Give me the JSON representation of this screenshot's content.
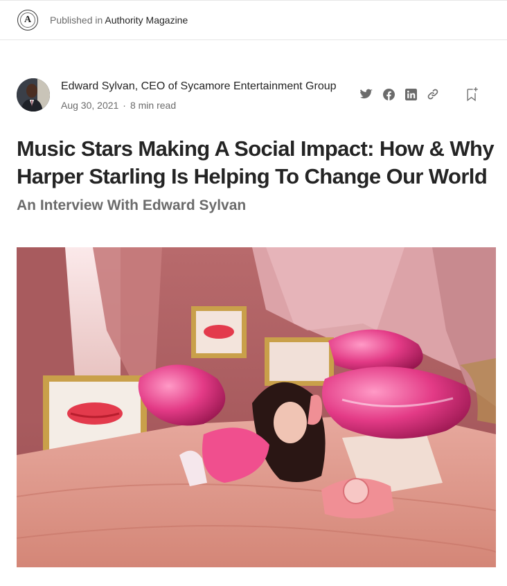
{
  "publication": {
    "prefix": "Published in",
    "name": "Authority Magazine",
    "logo_letter": "A"
  },
  "author": {
    "name": "Edward Sylvan, CEO of Sycamore Entertainment Group",
    "date": "Aug 30, 2021",
    "separator": "·",
    "read_time": "8 min read"
  },
  "share_icons": [
    "twitter-icon",
    "facebook-icon",
    "linkedin-icon",
    "link-icon",
    "bookmark-add-icon"
  ],
  "article": {
    "title": "Music Stars Making A Social Impact: How & Why Harper Starling Is Helping To Change Our World",
    "subtitle": "An Interview With Edward Sylvan"
  },
  "colors": {
    "text_primary": "#242424",
    "text_secondary": "#6b6b6b",
    "icon_gray": "#6b6b6b"
  }
}
